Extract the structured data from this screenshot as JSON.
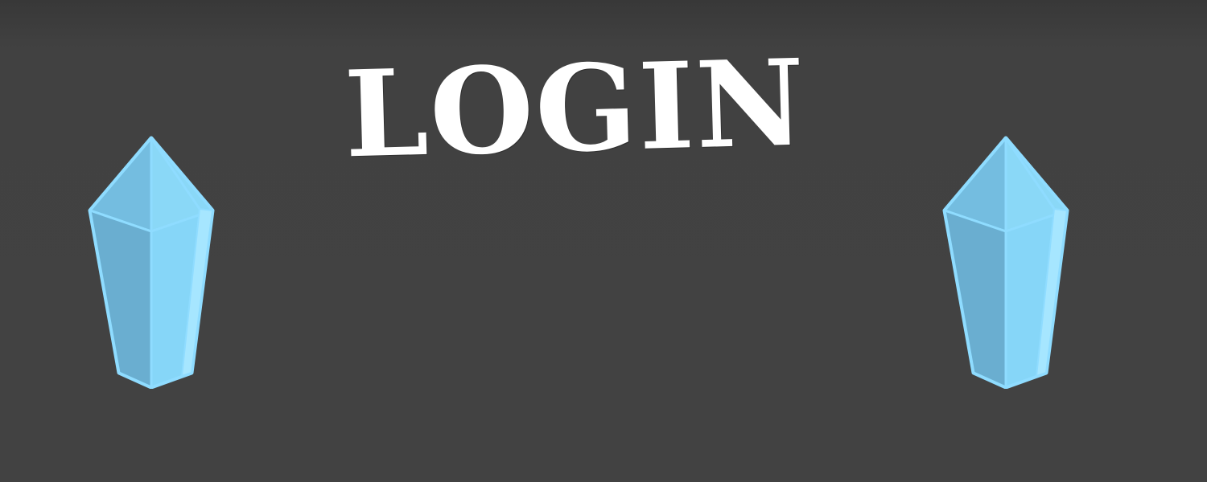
{
  "screen": {
    "title": "LOGIN"
  },
  "decorations": {
    "left_crystal": "crystal-icon",
    "right_crystal": "crystal-icon"
  },
  "colors": {
    "background": "#424242",
    "title": "#ffffff",
    "crystal_outline": "#8fdcff",
    "crystal_fill_dark": "#6aaed0",
    "crystal_fill_light": "#86d6f8"
  }
}
